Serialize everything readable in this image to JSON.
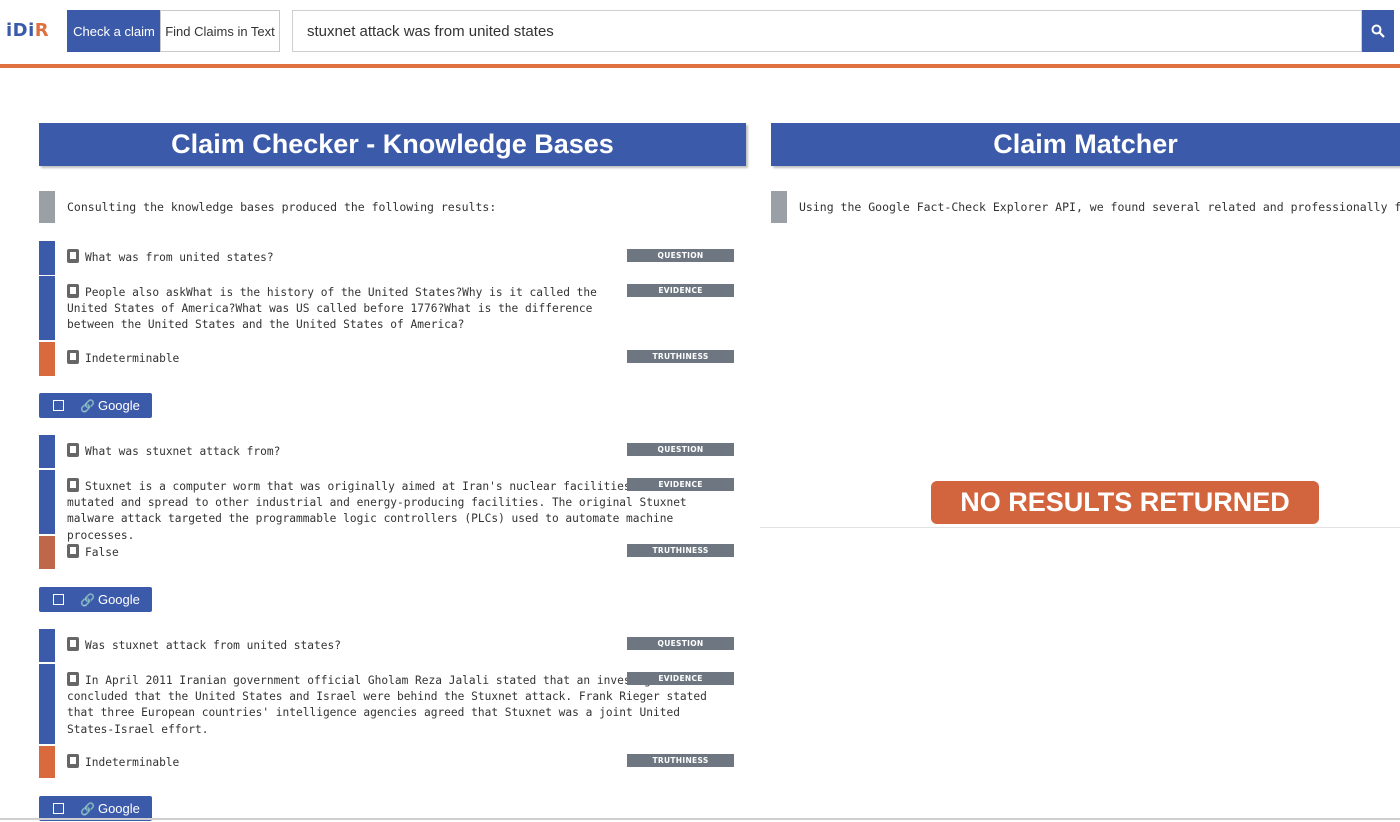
{
  "header": {
    "logo_part1": "iDi",
    "logo_part2": "R",
    "tabs": [
      "Check a claim",
      "Find Claims in Text"
    ],
    "search_value": "stuxnet attack was from united states",
    "search_icon": "search-icon"
  },
  "left": {
    "title": "Claim Checker - Knowledge Bases",
    "intro": "Consulting the knowledge bases produced the following results:",
    "tag_question": "QUESTION",
    "tag_evidence": "EVIDENCE",
    "tag_truthiness": "TRUTHINESS",
    "google_label": "Google",
    "results": [
      {
        "question": "What was from united states?",
        "evidence": "People also askWhat is the history of the United States?Why is it called the United States of America?What was US called before 1776?What is the difference between the United States and the United States of America?",
        "truthiness": "Indeterminable"
      },
      {
        "question": "What was stuxnet attack from?",
        "evidence": "Stuxnet is a computer worm that was originally aimed at Iran's nuclear facilities and has since mutated and spread to other industrial and energy-producing facilities. The original Stuxnet malware attack targeted the programmable logic controllers (PLCs) used to automate machine processes.",
        "truthiness": "False"
      },
      {
        "question": "Was stuxnet attack from united states?",
        "evidence": "In April 2011 Iranian government official Gholam Reza Jalali stated that an investigation had concluded that the United States and Israel were behind the Stuxnet attack. Frank Rieger stated that three European countries' intelligence agencies agreed that Stuxnet was a joint United States-Israel effort.",
        "truthiness": "Indeterminable"
      }
    ]
  },
  "right": {
    "title": "Claim Matcher",
    "intro": "Using the Google Fact-Check Explorer API, we found several related and professionally fact-checked clai",
    "no_results": "NO RESULTS RETURNED"
  },
  "colors": {
    "primary": "#3c5aaa",
    "accent_orange": "#e0703f",
    "tag_gray": "#6e7781"
  }
}
